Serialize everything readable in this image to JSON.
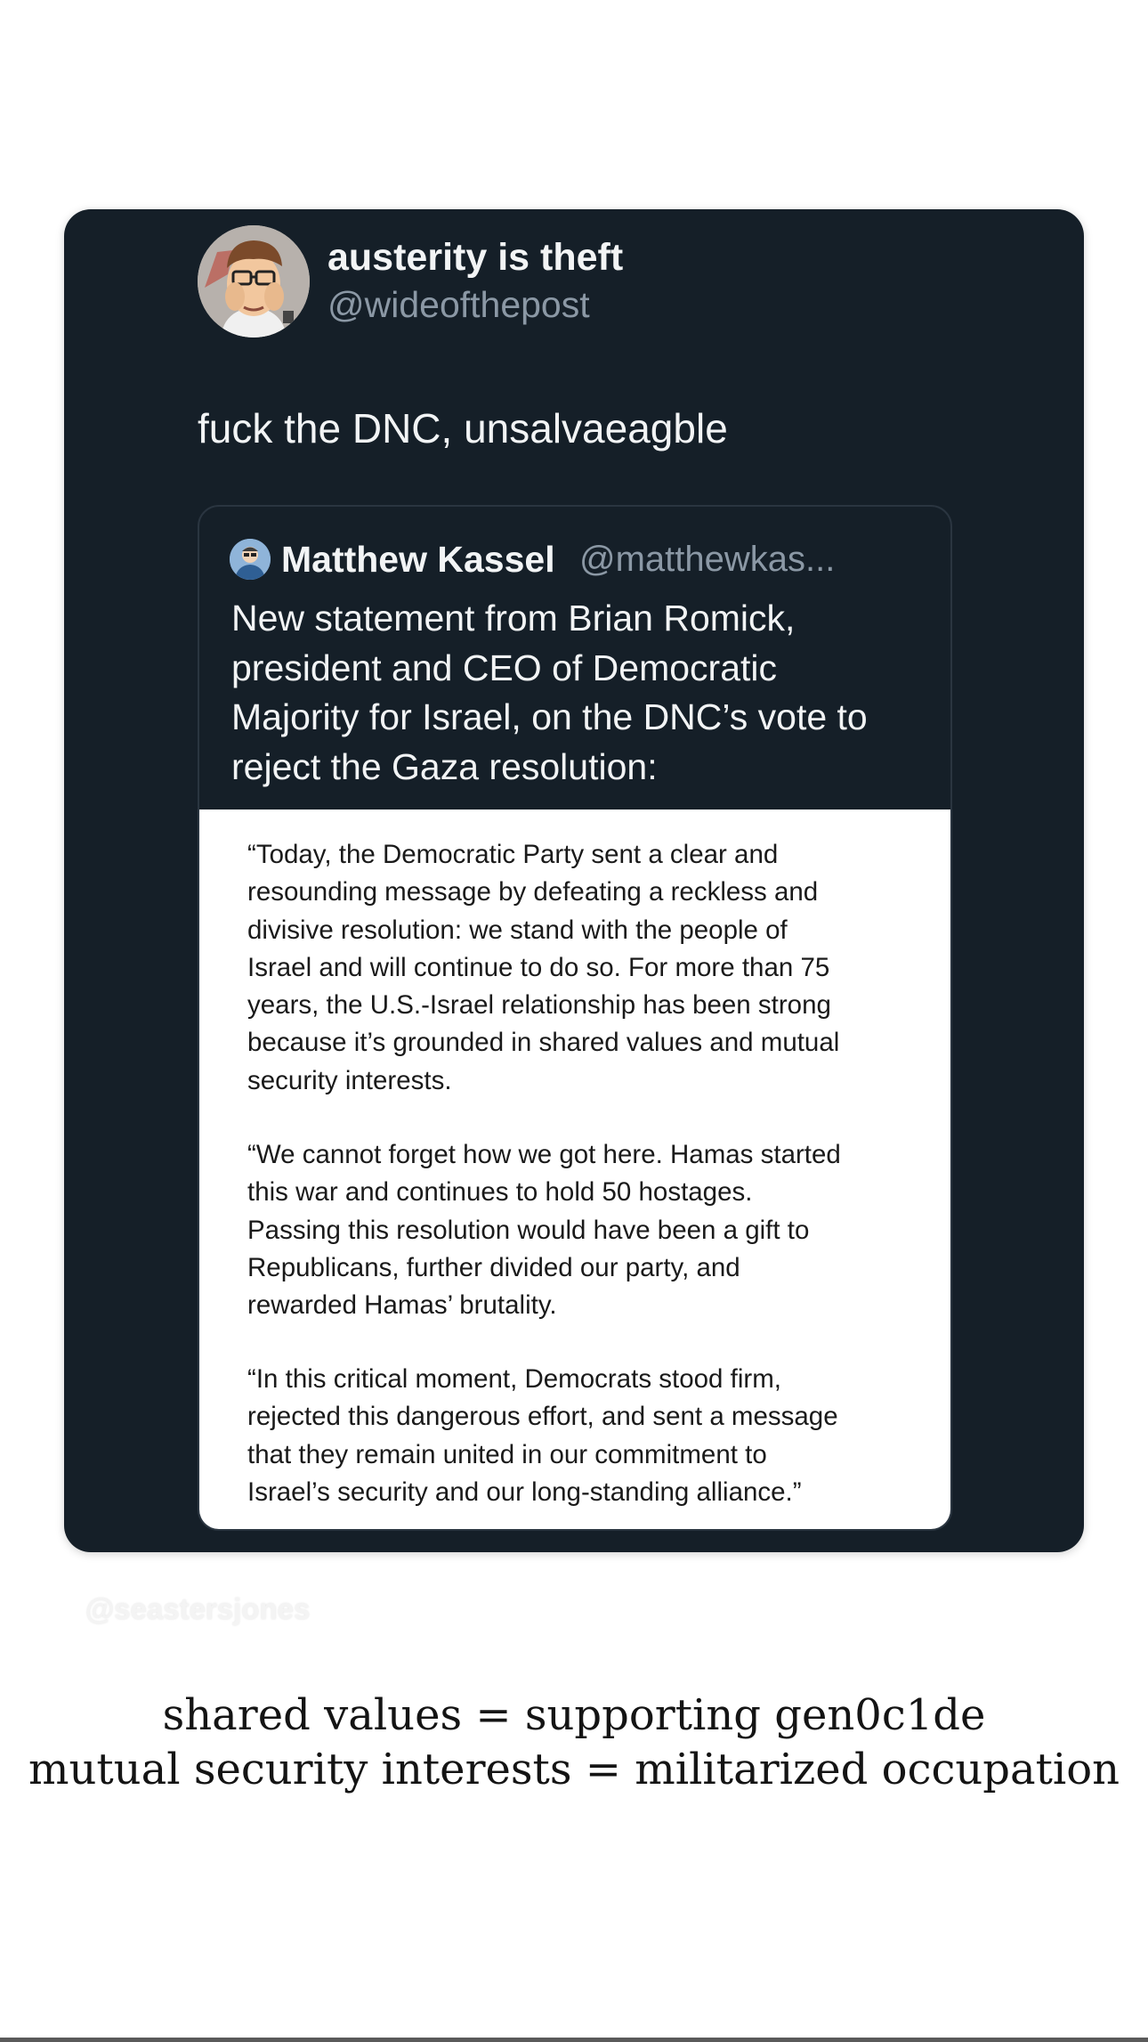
{
  "tweet": {
    "author_name": "austerity is theft",
    "author_handle": "@wideofthepost",
    "avatar": "cartoon-avatar-icon",
    "text": "fuck the DNC, unsalvaeagble"
  },
  "quoted_tweet": {
    "author_name": "Matthew Kassel",
    "author_handle": "@matthewkas...",
    "avatar": "user-avatar-icon",
    "text_lines": [
      "New statement from Brian Romick,",
      "president and CEO of Democratic",
      "Majority for Israel, on the DNC’s vote to",
      "reject the Gaza resolution:"
    ],
    "statement": {
      "paragraph_1": [
        "“Today, the Democratic Party sent a clear and",
        "resounding message by defeating a reckless and",
        "divisive resolution: we stand with the people of",
        "Israel and will continue to do so. For more than 75",
        "years, the U.S.-Israel relationship has been strong",
        "because it’s grounded in shared values and mutual",
        "security interests."
      ],
      "paragraph_2": [
        "“We cannot forget how we got here. Hamas started",
        "this war and continues to hold 50 hostages.",
        "Passing this resolution would have been a gift to",
        "Republicans, further divided our party, and",
        "rewarded Hamas’ brutality."
      ],
      "paragraph_3": [
        "“In this critical moment, Democrats stood firm,",
        "rejected this dangerous effort, and sent a message",
        "that they remain united in our commitment to",
        "Israel’s security and our long-standing alliance.”"
      ]
    }
  },
  "watermark": "@seastersjones",
  "caption": {
    "line1": "shared values = supporting gen0c1de",
    "line2": "mutual security interests = militarized occupation"
  },
  "colors": {
    "card_background": "#151f28",
    "primary_text": "#f2f4f5",
    "handle_text": "#8b98a5",
    "statement_background": "#ffffff"
  }
}
